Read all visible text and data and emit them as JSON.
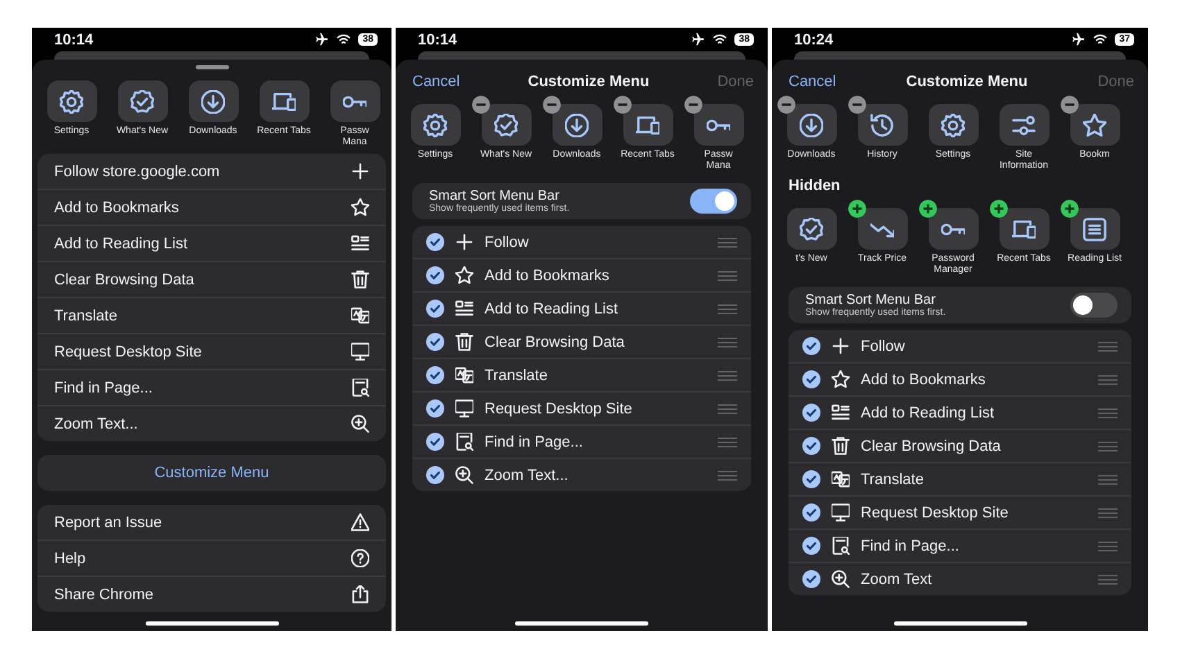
{
  "screens": [
    {
      "kind": "menu",
      "status": {
        "time": "10:14",
        "battery": "38"
      },
      "tiles": [
        {
          "label": "Settings",
          "kind": "gear"
        },
        {
          "label": "What's New",
          "kind": "badge-check"
        },
        {
          "label": "Downloads",
          "kind": "download"
        },
        {
          "label": "Recent Tabs",
          "kind": "devices"
        },
        {
          "label": "Passw\nMana",
          "kind": "key"
        }
      ],
      "menu_items": [
        {
          "label": "Follow store.google.com",
          "kind": "plus"
        },
        {
          "label": "Add to Bookmarks",
          "kind": "star"
        },
        {
          "label": "Add to Reading List",
          "kind": "reading"
        },
        {
          "label": "Clear Browsing Data",
          "kind": "trash"
        },
        {
          "label": "Translate",
          "kind": "translate"
        },
        {
          "label": "Request Desktop Site",
          "kind": "desktop"
        },
        {
          "label": "Find in Page...",
          "kind": "find"
        },
        {
          "label": "Zoom Text...",
          "kind": "zoom"
        }
      ],
      "customize_button": "Customize Menu",
      "footer_items": [
        {
          "label": "Report an Issue",
          "kind": "warning"
        },
        {
          "label": "Help",
          "kind": "help"
        },
        {
          "label": "Share Chrome",
          "kind": "share"
        }
      ]
    },
    {
      "kind": "customize",
      "status": {
        "time": "10:14",
        "battery": "38"
      },
      "header": {
        "cancel": "Cancel",
        "title": "Customize Menu",
        "done": {
          "label": "Done",
          "disabled": true
        }
      },
      "tiles": [
        {
          "label": "Settings",
          "kind": "gear",
          "removable": false
        },
        {
          "label": "What's New",
          "kind": "badge-check",
          "removable": true
        },
        {
          "label": "Downloads",
          "kind": "download",
          "removable": true
        },
        {
          "label": "Recent Tabs",
          "kind": "devices",
          "removable": true
        },
        {
          "label": "Passw\nMana",
          "kind": "key",
          "removable": true
        }
      ],
      "smart_sort": {
        "title": "Smart Sort Menu Bar",
        "subtitle": "Show frequently used items first.",
        "on": true
      },
      "items": [
        {
          "label": "Follow",
          "kind": "plus",
          "checked": true
        },
        {
          "label": "Add to Bookmarks",
          "kind": "star",
          "checked": true
        },
        {
          "label": "Add to Reading List",
          "kind": "reading",
          "checked": true
        },
        {
          "label": "Clear Browsing Data",
          "kind": "trash",
          "checked": true
        },
        {
          "label": "Translate",
          "kind": "translate",
          "checked": true
        },
        {
          "label": "Request Desktop Site",
          "kind": "desktop",
          "checked": true
        },
        {
          "label": "Find in Page...",
          "kind": "find",
          "checked": true
        },
        {
          "label": "Zoom Text...",
          "kind": "zoom",
          "checked": true
        }
      ]
    },
    {
      "kind": "customize",
      "status": {
        "time": "10:24",
        "battery": "37"
      },
      "header": {
        "cancel": "Cancel",
        "title": "Customize Menu",
        "done": {
          "label": "Done",
          "disabled": true
        }
      },
      "tiles": [
        {
          "label": "Downloads",
          "kind": "download",
          "removable": true
        },
        {
          "label": "History",
          "kind": "history",
          "removable": true
        },
        {
          "label": "Settings",
          "kind": "gear",
          "removable": false
        },
        {
          "label": "Site\nInformation",
          "kind": "sliders",
          "removable": false
        },
        {
          "label": "Bookm",
          "kind": "star",
          "removable": true
        }
      ],
      "hidden": {
        "heading": "Hidden",
        "tiles": [
          {
            "label": "t's New",
            "kind": "badge-check",
            "addable": false
          },
          {
            "label": "Track Price",
            "kind": "trend",
            "addable": true
          },
          {
            "label": "Password\nManager",
            "kind": "key",
            "addable": true
          },
          {
            "label": "Recent Tabs",
            "kind": "devices",
            "addable": true
          },
          {
            "label": "Reading List",
            "kind": "list-box",
            "addable": true
          }
        ]
      },
      "smart_sort": {
        "title": "Smart Sort Menu Bar",
        "subtitle": "Show frequently used items first.",
        "on": false
      },
      "items": [
        {
          "label": "Follow",
          "kind": "plus",
          "checked": true
        },
        {
          "label": "Add to Bookmarks",
          "kind": "star",
          "checked": true
        },
        {
          "label": "Add to Reading List",
          "kind": "reading",
          "checked": true
        },
        {
          "label": "Clear Browsing Data",
          "kind": "trash",
          "checked": true
        },
        {
          "label": "Translate",
          "kind": "translate",
          "checked": true
        },
        {
          "label": "Request Desktop Site",
          "kind": "desktop",
          "checked": true
        },
        {
          "label": "Find in Page...",
          "kind": "find",
          "checked": true
        },
        {
          "label": "Zoom Text",
          "kind": "zoom",
          "checked": true
        }
      ]
    }
  ]
}
